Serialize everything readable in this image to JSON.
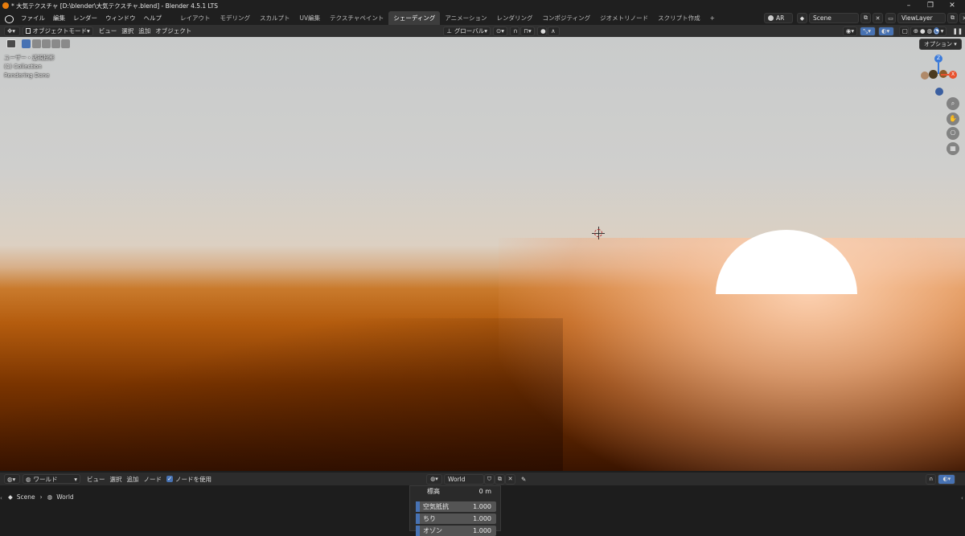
{
  "window": {
    "title": "* 大気テクスチャ [D:\\blender\\大気テクスチャ.blend] - Blender 4.5.1 LTS",
    "minimize": "–",
    "maximize": "❐",
    "close": "✕"
  },
  "menu": {
    "items": [
      "ファイル",
      "編集",
      "レンダー",
      "ウィンドウ",
      "ヘルプ"
    ]
  },
  "workspaces": {
    "tabs": [
      "レイアウト",
      "モデリング",
      "スカルプト",
      "UV編集",
      "テクスチャペイント",
      "シェーディング",
      "アニメーション",
      "レンダリング",
      "コンポジティング",
      "ジオメトリノード",
      "スクリプト作成"
    ],
    "active_index": 5,
    "add": "+"
  },
  "topright": {
    "ar_label": "AR",
    "scene_value": "Scene",
    "viewlayer_value": "ViewLayer"
  },
  "viewport_header": {
    "mode": "オブジェクトモード",
    "menus": [
      "ビュー",
      "選択",
      "追加",
      "オブジェクト"
    ],
    "transform_orientation": "グローバル"
  },
  "viewport": {
    "overlay_lines": [
      "ユーザー・透視投影",
      "(1) Collection",
      "Rendering Done"
    ],
    "options_button": "オプション",
    "gizmo": {
      "z": "Z",
      "x": "X"
    },
    "colors": {
      "accent": "#4772b3",
      "x_axis": "#e8522e",
      "y_axis": "#6b8e23",
      "z_axis": "#3b7ad9"
    }
  },
  "node_editor": {
    "editor_type": "ワールド",
    "menus": [
      "ビュー",
      "選択",
      "追加",
      "ノード"
    ],
    "use_nodes_label": "ノードを使用",
    "use_nodes_checked": true,
    "world_name": "World",
    "breadcrumb": [
      "Scene",
      "World"
    ],
    "node_rows": [
      {
        "label": "標高",
        "value": "0 m",
        "bar": false
      },
      {
        "label": "空気抵抗",
        "value": "1.000",
        "bar": true
      },
      {
        "label": "ちり",
        "value": "1.000",
        "bar": true
      },
      {
        "label": "オゾン",
        "value": "1.000",
        "bar": true
      }
    ]
  }
}
